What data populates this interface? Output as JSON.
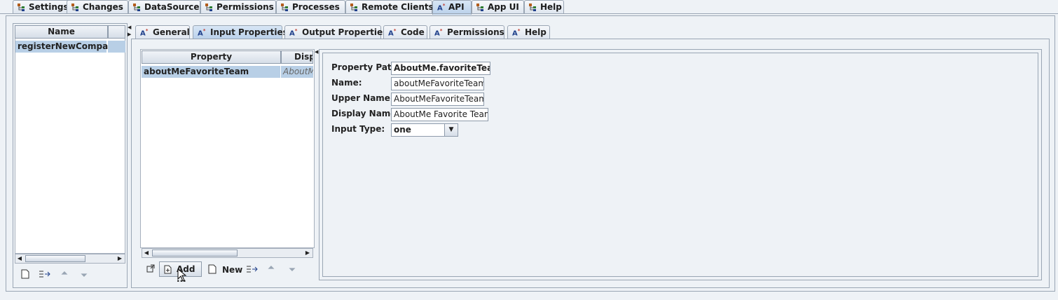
{
  "top_tabs": [
    {
      "label": "Settings",
      "active": false
    },
    {
      "label": "Changes",
      "active": false
    },
    {
      "label": "DataSource",
      "active": false
    },
    {
      "label": "Permissions",
      "active": false
    },
    {
      "label": "Processes",
      "active": false
    },
    {
      "label": "Remote Clients",
      "active": false
    },
    {
      "label": "API",
      "active": true
    },
    {
      "label": "App UI",
      "active": false
    },
    {
      "label": "Help",
      "active": false
    }
  ],
  "left_list": {
    "header": "Name",
    "rows": [
      "registerNewCompany"
    ]
  },
  "sub_tabs": [
    {
      "label": "General",
      "active": false
    },
    {
      "label": "Input Properties",
      "active": true
    },
    {
      "label": "Output Properties",
      "active": false
    },
    {
      "label": "Code",
      "active": false
    },
    {
      "label": "Permissions",
      "active": false
    },
    {
      "label": "Help",
      "active": false
    }
  ],
  "property_table": {
    "headers": [
      "Property",
      "Displ"
    ],
    "rows": [
      {
        "property": "aboutMeFavoriteTeam",
        "display": "AboutMe"
      }
    ]
  },
  "bottom_toolbar": {
    "add_label": "Add ...",
    "new_label": "New"
  },
  "form": {
    "property_path_label": "Property Path:",
    "property_path_value": "AboutMe.favoriteTeam",
    "name_label": "Name:",
    "name_value": "aboutMeFavoriteTeam",
    "upper_name_label": "Upper Name:",
    "upper_name_value": "AboutMeFavoriteTeam",
    "display_name_label": "Display Name:",
    "display_name_value": "AboutMe Favorite Team",
    "input_type_label": "Input Type:",
    "input_type_value": "one"
  }
}
